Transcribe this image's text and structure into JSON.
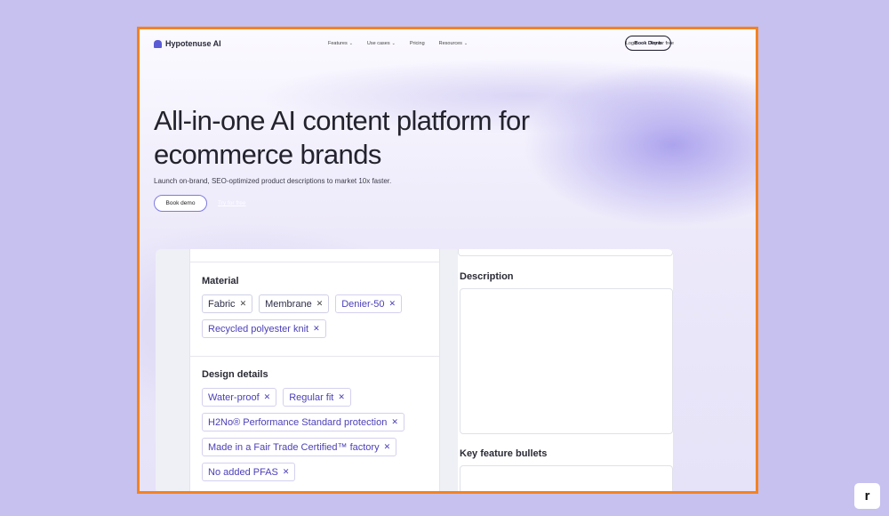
{
  "nav": {
    "logo_text": "Hypotenuse AI",
    "menu": [
      {
        "label": "Features",
        "chevron": true
      },
      {
        "label": "Use cases",
        "chevron": true
      },
      {
        "label": "Pricing",
        "chevron": false
      },
      {
        "label": "Resources",
        "chevron": true
      }
    ],
    "login": "Login",
    "try_free": "Try for free",
    "book_demo": "Book Demo"
  },
  "hero": {
    "title_line1": "All-in-one AI content platform for",
    "title_line2": "ecommerce brands",
    "subtitle": "Launch on-brand, SEO-optimized product descriptions to market 10x faster.",
    "book_demo": "Book demo",
    "try_free": "Try for free"
  },
  "editor": {
    "material": {
      "label": "Material",
      "chips": [
        "Fabric",
        "Membrane",
        "Denier-50",
        "Recycled polyester knit"
      ]
    },
    "design_details": {
      "label": "Design details",
      "chips": [
        "Water-proof",
        "Regular fit",
        "H2No® Performance Standard protection",
        "Made in a Fair Trade Certified™ factory",
        "No added PFAS"
      ]
    },
    "description_label": "Description",
    "key_features_label": "Key feature bullets"
  },
  "badge": "r",
  "colors": {
    "background": "#c6c1ef",
    "frame_border": "#f58220",
    "accent": "#5b5bd6",
    "chip_text_purple": "#4b3fb8"
  },
  "icons": {
    "logo": "hypotenuse-logo-icon",
    "chip_remove": "close-icon",
    "dropdown": "chevron-down-icon"
  }
}
